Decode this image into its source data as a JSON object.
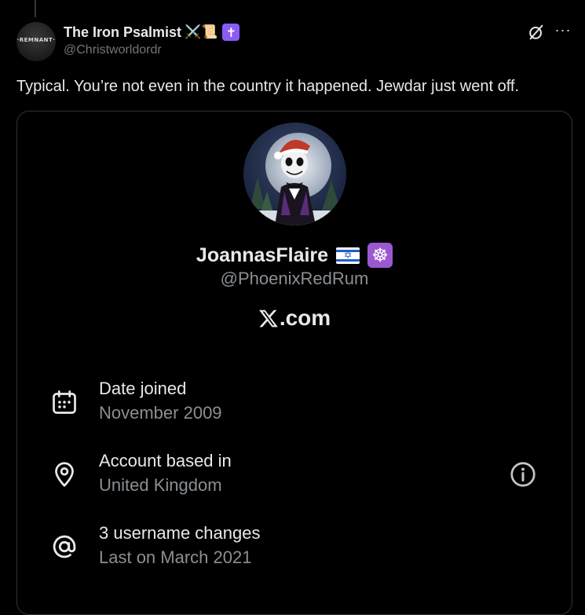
{
  "post": {
    "author": {
      "display_name": "The Iron Psalmist",
      "name_emojis": "⚔️📜",
      "badge_glyph": "✝",
      "handle": "@Christworldordr",
      "avatar_text": "·REMNANT·"
    },
    "text": "Typical. You’re not even in the country it happened. Jewdar just went off.",
    "icons": {
      "grok": "grok-icon",
      "more": "more-icon",
      "more_glyph": "···"
    }
  },
  "card": {
    "profile_name": "JoannasFlaire",
    "flag": "israel-flag",
    "flag_star": "✡",
    "badge_glyph": "☸",
    "profile_handle": "@PhoenixRedRum",
    "site": ".com",
    "rows": [
      {
        "icon": "calendar-icon",
        "title": "Date joined",
        "value": "November 2009"
      },
      {
        "icon": "location-pin-icon",
        "title": "Account based in",
        "value": "United Kingdom"
      },
      {
        "icon": "at-sign-icon",
        "title": "3 username changes",
        "value": "Last on March 2021"
      }
    ]
  },
  "colors": {
    "background": "#000000",
    "text_primary": "#e7e9ea",
    "text_secondary": "#71767b",
    "border": "#2f3336",
    "badge_purple": "#8a5cf6"
  }
}
